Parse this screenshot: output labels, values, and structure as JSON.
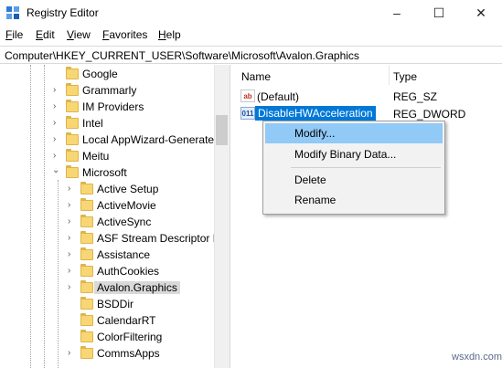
{
  "window": {
    "title": "Registry Editor"
  },
  "menu": [
    {
      "accel": "F",
      "rest": "ile"
    },
    {
      "accel": "E",
      "rest": "dit"
    },
    {
      "accel": "V",
      "rest": "iew"
    },
    {
      "accel": "F",
      "rest": "avorites",
      "prefix": ""
    },
    {
      "accel": "H",
      "rest": "elp"
    }
  ],
  "menu_full": [
    "File",
    "Edit",
    "View",
    "Favorites",
    "Help"
  ],
  "address": "Computer\\HKEY_CURRENT_USER\\Software\\Microsoft\\Avalon.Graphics",
  "tree": {
    "items": [
      {
        "label": "Google"
      },
      {
        "label": "Grammarly"
      },
      {
        "label": "IM Providers"
      },
      {
        "label": "Intel"
      },
      {
        "label": "Local AppWizard-Generated"
      },
      {
        "label": "Meitu"
      },
      {
        "label": "Microsoft",
        "expanded": true
      },
      {
        "label": "Active Setup"
      },
      {
        "label": "ActiveMovie"
      },
      {
        "label": "ActiveSync"
      },
      {
        "label": "ASF Stream Descriptor Fi"
      },
      {
        "label": "Assistance"
      },
      {
        "label": "AuthCookies"
      },
      {
        "label": "Avalon.Graphics",
        "selected": true
      },
      {
        "label": "BSDDir"
      },
      {
        "label": "CalendarRT"
      },
      {
        "label": "ColorFiltering"
      },
      {
        "label": "CommsApps"
      }
    ]
  },
  "list": {
    "headers": {
      "name": "Name",
      "type": "Type"
    },
    "rows": [
      {
        "icon": "ab",
        "name": "(Default)",
        "type": "REG_SZ"
      },
      {
        "icon": "011",
        "name": "DisableHWAcceleration",
        "type": "REG_DWORD",
        "selected": true
      }
    ]
  },
  "context_menu": {
    "items": [
      "Modify...",
      "Modify Binary Data...",
      "Delete",
      "Rename"
    ]
  },
  "watermark": "wsxdn.com",
  "icons": {
    "app": "registry-editor-icon",
    "minimize": "–",
    "maximize": "☐",
    "close": "✕",
    "collapsed": "›",
    "expanded": "⌄"
  }
}
